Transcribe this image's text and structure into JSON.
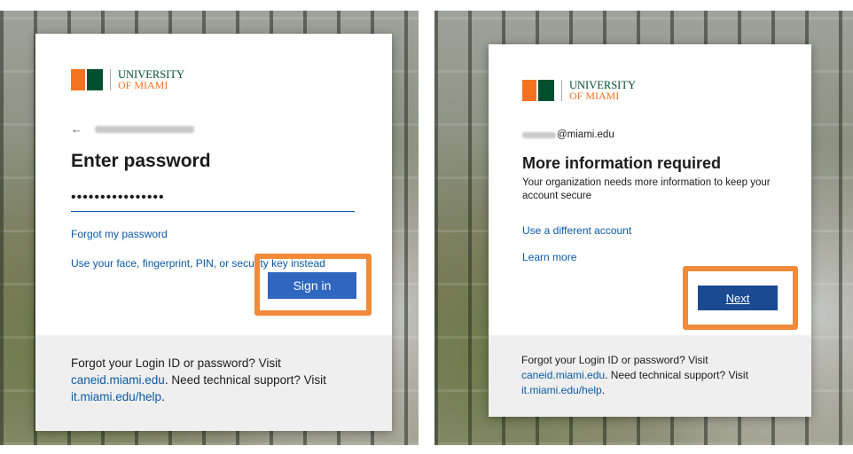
{
  "left_screen": {
    "logo": {
      "line1": "UNIVERSITY",
      "line2": "OF MIAMI"
    },
    "back_arrow": "←",
    "title": "Enter password",
    "password_value": "••••••••••••••••",
    "forgot_password_link": "Forgot my password",
    "alt_signin_link": "Use your face, fingerprint, PIN, or security key instead",
    "sign_in_button": "Sign in",
    "footer": {
      "text1": "Forgot your Login ID or password? Visit",
      "link1": "caneid.miami.edu",
      "text2": ". Need technical support? Visit",
      "link2": "it.miami.edu/help",
      "text3": "."
    }
  },
  "right_screen": {
    "logo": {
      "line1": "UNIVERSITY",
      "line2": "OF MIAMI"
    },
    "email_suffix": "@miami.edu",
    "title": "More information required",
    "info_text": "Your organization needs more information to keep your account secure",
    "different_account_link": "Use a different account",
    "learn_more_link": "Learn more",
    "next_button": "Next",
    "footer": {
      "text1": "Forgot your Login ID or password? Visit",
      "link1": "caneid.miami.edu",
      "text2": ". Need technical support? Visit",
      "link2": "it.miami.edu/help",
      "text3": "."
    }
  },
  "colors": {
    "highlight": "#f28a3a",
    "link": "#0b5aa6",
    "sign_in_button": "#2f66c0",
    "next_button": "#1b4a93",
    "brand_orange": "#f47321",
    "brand_green": "#005030"
  }
}
